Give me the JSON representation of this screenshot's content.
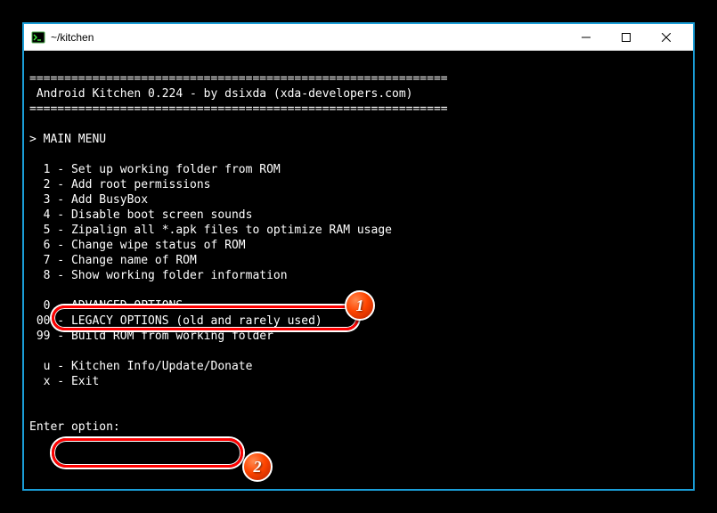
{
  "titlebar": {
    "title": "~/kitchen"
  },
  "terminal": {
    "sep_top": "============================================================",
    "header": " Android Kitchen 0.224 - by dsixda (xda-developers.com)",
    "sep_bot": "============================================================",
    "menu_title": "> MAIN MENU",
    "items": {
      "i1": "  1 - Set up working folder from ROM",
      "i2": "  2 - Add root permissions",
      "i3": "  3 - Add BusyBox",
      "i4": "  4 - Disable boot screen sounds",
      "i5": "  5 - Zipalign all *.apk files to optimize RAM usage",
      "i6": "  6 - Change wipe status of ROM",
      "i7": "  7 - Change name of ROM",
      "i8": "  8 - Show working folder information",
      "i0": "  0 - ADVANCED OPTIONS",
      "i00": " 00 - LEGACY OPTIONS (old and rarely used)",
      "i99": " 99 - Build ROM from working folder",
      "iu": "  u - Kitchen Info/Update/Donate",
      "ix": "  x - Exit"
    },
    "prompt": "Enter option:"
  },
  "annotations": {
    "badge1": "1",
    "badge2": "2"
  }
}
